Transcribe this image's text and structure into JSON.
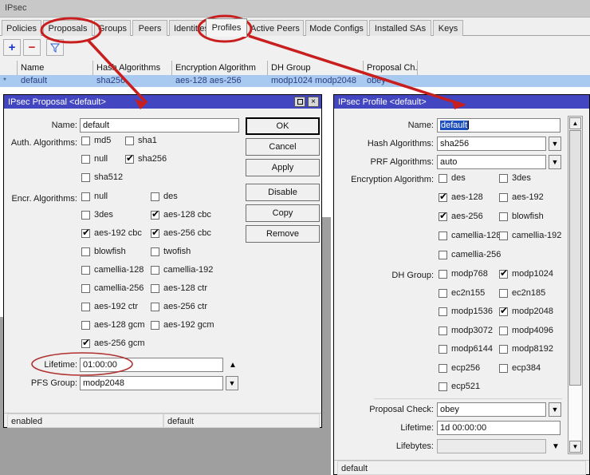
{
  "window": {
    "title": "IPsec",
    "tabs": [
      {
        "label": "Policies",
        "active": false
      },
      {
        "label": "Proposals",
        "active": false
      },
      {
        "label": "Groups",
        "active": false
      },
      {
        "label": "Peers",
        "active": false
      },
      {
        "label": "Identities",
        "active": false
      },
      {
        "label": "Profiles",
        "active": true
      },
      {
        "label": "Active Peers",
        "active": false
      },
      {
        "label": "Mode Configs",
        "active": false
      },
      {
        "label": "Installed SAs",
        "active": false
      },
      {
        "label": "Keys",
        "active": false
      }
    ],
    "toolbar": {
      "add_label": "+",
      "remove_label": "−",
      "filter_icon": "funnel-icon"
    },
    "table": {
      "columns": [
        "Name",
        "Hash Algorithms",
        "Encryption Algorithm",
        "DH Group",
        "Proposal Ch..."
      ],
      "rows": [
        {
          "flag": "*",
          "name": "default",
          "hash": "sha256",
          "encryption": "aes-128 aes-256",
          "dh_group": "modp1024 modp2048",
          "proposal_check": "obey"
        }
      ]
    }
  },
  "proposal_dialog": {
    "title": "IPsec Proposal <default>",
    "titlebar_buttons": {
      "maximize": "maximize-icon",
      "close": "×"
    },
    "fields": {
      "name_label": "Name:",
      "name_value": "default",
      "auth_label": "Auth. Algorithms:",
      "encr_label": "Encr. Algorithms:",
      "lifetime_label": "Lifetime:",
      "lifetime_value": "01:00:00",
      "pfs_label": "PFS Group:",
      "pfs_value": "modp2048"
    },
    "auth_algorithms": [
      {
        "label": "md5",
        "checked": false
      },
      {
        "label": "sha1",
        "checked": false
      },
      {
        "label": "null",
        "checked": false
      },
      {
        "label": "sha256",
        "checked": true
      },
      {
        "label": "sha512",
        "checked": false
      }
    ],
    "encr_algorithms": [
      {
        "label": "null",
        "checked": false
      },
      {
        "label": "des",
        "checked": false
      },
      {
        "label": "3des",
        "checked": false
      },
      {
        "label": "aes-128 cbc",
        "checked": true
      },
      {
        "label": "aes-192 cbc",
        "checked": true
      },
      {
        "label": "aes-256 cbc",
        "checked": true
      },
      {
        "label": "blowfish",
        "checked": false
      },
      {
        "label": "twofish",
        "checked": false
      },
      {
        "label": "camellia-128",
        "checked": false
      },
      {
        "label": "camellia-192",
        "checked": false
      },
      {
        "label": "camellia-256",
        "checked": false
      },
      {
        "label": "aes-128 ctr",
        "checked": false
      },
      {
        "label": "aes-192 ctr",
        "checked": false
      },
      {
        "label": "aes-256 ctr",
        "checked": false
      },
      {
        "label": "aes-128 gcm",
        "checked": false
      },
      {
        "label": "aes-192 gcm",
        "checked": false
      },
      {
        "label": "aes-256 gcm",
        "checked": true
      }
    ],
    "buttons": [
      "OK",
      "Cancel",
      "Apply",
      "Disable",
      "Copy",
      "Remove"
    ],
    "status": [
      "enabled",
      "default"
    ]
  },
  "profile_dialog": {
    "title": "IPsec Profile <default>",
    "fields": {
      "name_label": "Name:",
      "name_value": "default",
      "hash_label": "Hash Algorithms:",
      "hash_value": "sha256",
      "prf_label": "PRF Algorithms:",
      "prf_value": "auto",
      "encryption_label": "Encryption Algorithm:",
      "dh_label": "DH Group:",
      "proposal_check_label": "Proposal Check:",
      "proposal_check_value": "obey",
      "lifetime_label": "Lifetime:",
      "lifetime_value": "1d 00:00:00",
      "lifebytes_label": "Lifebytes:",
      "lifebytes_value": ""
    },
    "encryption_algorithms": [
      {
        "label": "des",
        "checked": false
      },
      {
        "label": "3des",
        "checked": false
      },
      {
        "label": "aes-128",
        "checked": true
      },
      {
        "label": "aes-192",
        "checked": false
      },
      {
        "label": "aes-256",
        "checked": true
      },
      {
        "label": "blowfish",
        "checked": false
      },
      {
        "label": "camellia-128",
        "checked": false
      },
      {
        "label": "camellia-192",
        "checked": false
      },
      {
        "label": "camellia-256",
        "checked": false
      }
    ],
    "dh_groups": [
      {
        "label": "modp768",
        "checked": false
      },
      {
        "label": "modp1024",
        "checked": true
      },
      {
        "label": "ec2n155",
        "checked": false
      },
      {
        "label": "ec2n185",
        "checked": false
      },
      {
        "label": "modp1536",
        "checked": false
      },
      {
        "label": "modp2048",
        "checked": true
      },
      {
        "label": "modp3072",
        "checked": false
      },
      {
        "label": "modp4096",
        "checked": false
      },
      {
        "label": "modp6144",
        "checked": false
      },
      {
        "label": "modp8192",
        "checked": false
      },
      {
        "label": "ecp256",
        "checked": false
      },
      {
        "label": "ecp384",
        "checked": false
      },
      {
        "label": "ecp521",
        "checked": false
      }
    ],
    "status": [
      "default"
    ]
  },
  "annotations": {
    "color": "#c81e1e",
    "ellipses": [
      "Proposals",
      "Profiles",
      "Lifetime"
    ],
    "arrows": 2
  }
}
